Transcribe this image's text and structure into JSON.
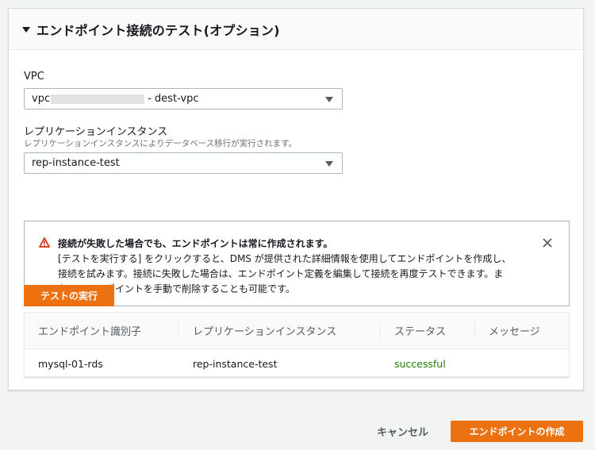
{
  "section": {
    "title": "エンドポイント接続のテスト(オプション)"
  },
  "vpc": {
    "label": "VPC",
    "value_prefix": "vpc",
    "value_suffix": "- dest-vpc"
  },
  "replication": {
    "label": "レプリケーションインスタンス",
    "description": "レプリケーションインスタンスによりデータベース移行が実行されます。",
    "value": "rep-instance-test"
  },
  "alert": {
    "title": "接続が失敗した場合でも、エンドポイントは常に作成されます。",
    "lines": [
      "[テストを実行する] をクリックすると、DMS が提供された詳細情報を使用してエンドポイントを作成し、",
      "接続を試みます。接続に失敗した場合は、エンドポイント定義を編集して接続を再度テストできます。ま",
      "た、エンドポイントを手動で削除することも可能です。"
    ]
  },
  "run_test_label": "テストの実行",
  "table": {
    "headers": [
      "エンドポイント識別子",
      "レプリケーションインスタンス",
      "ステータス",
      "メッセージ"
    ],
    "rows": [
      {
        "endpoint": "mysql-01-rds",
        "instance": "rep-instance-test",
        "status": "successful",
        "message": ""
      }
    ]
  },
  "footer": {
    "cancel_label": "キャンセル",
    "create_label": "エンドポイントの作成"
  },
  "colors": {
    "accent": "#ec7211",
    "success": "#1d8102",
    "warning": "#d13212"
  }
}
